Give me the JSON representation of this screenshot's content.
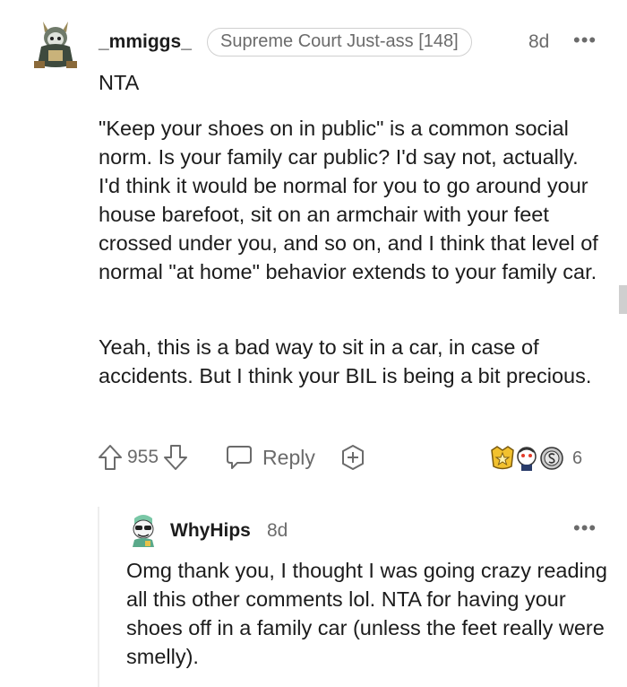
{
  "comment": {
    "username": "_mmiggs_",
    "flair": "Supreme Court Just-ass [148]",
    "age": "8d",
    "more_label": "•••",
    "paragraphs": [
      "NTA",
      "\"Keep your shoes on in public\" is a common social norm. Is your family car public? I'd say not, actually. I'd think it would be normal for you to go around your house barefoot, sit on an armchair with your feet crossed under you, and so on, and I think that level of normal \"at home\" behavior extends to your family car.",
      "Yeah, this is a bad way to sit in a car, in case of accidents. But I think your BIL is being a bit precious."
    ],
    "score": "955",
    "reply_label": "Reply",
    "award_count": "6"
  },
  "reply": {
    "username": "WhyHips",
    "age": "8d",
    "more_label": "•••",
    "text": "Omg thank you, I thought I was going crazy reading all this other comments lol. NTA for having your shoes off in a family car (unless the feet really were smelly)."
  },
  "colors": {
    "text": "#1c1c1c",
    "meta": "#6b6b6b",
    "flair_border": "#d0d0d0",
    "thread_line": "#ededed",
    "scrollbar": "#cfcfcf"
  },
  "icons": [
    "upvote-icon",
    "downvote-icon",
    "comment-icon",
    "add-award-icon",
    "award-icon"
  ]
}
